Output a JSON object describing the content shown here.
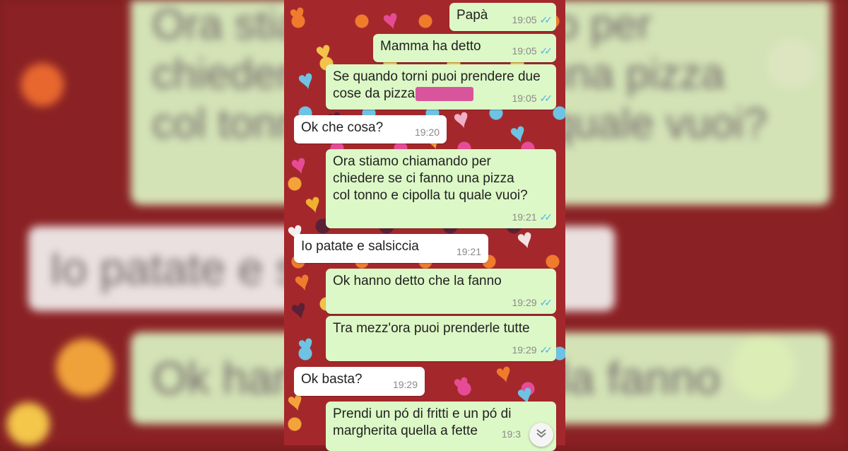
{
  "messages": [
    {
      "text": "Papà",
      "time": "19:05",
      "dir": "out"
    },
    {
      "text": "Mamma ha detto",
      "time": "19:05",
      "dir": "out"
    },
    {
      "text_line1": "Se quando torni puoi prendere due",
      "text_line2": "cose da pizza",
      "time": "19:05",
      "dir": "out"
    },
    {
      "text": "Ok che cosa?",
      "time": "19:20",
      "dir": "in"
    },
    {
      "text": "Ora stiamo chiamando per\nchiedere se ci fanno una pizza\ncol tonno e cipolla tu quale vuoi?",
      "time": "19:21",
      "dir": "out"
    },
    {
      "text": "Io patate e salsiccia",
      "time": "19:21",
      "dir": "in"
    },
    {
      "text": "Ok hanno detto che la fanno",
      "time": "19:29",
      "dir": "out"
    },
    {
      "text": "Tra mezz'ora puoi prenderle tutte",
      "time": "19:29",
      "dir": "out"
    },
    {
      "text": "Ok basta?",
      "time": "19:29",
      "dir": "in"
    },
    {
      "text": "Prendi un pó di fritti e un pó di\nmargherita quella a fette",
      "time": "19:3",
      "dir": "out"
    }
  ],
  "background": {
    "bubble1": "Ora stiamo chiamando per\nchiedere se ci fanno una pizza\ncol tonno e cipolla tu quale vuoi?",
    "bubble2": "Io patate e salsiccia",
    "bubble3": "Ok hanno detto che la fanno"
  },
  "icons": {
    "read_receipt": "double-check-icon",
    "scroll_down": "chevron-down-icon"
  },
  "colors": {
    "outgoing": "#dcf8c6",
    "incoming": "#ffffff",
    "ticks": "#4fb3e8",
    "wallpaper": "#a4282b",
    "redaction": "#d8559c"
  }
}
